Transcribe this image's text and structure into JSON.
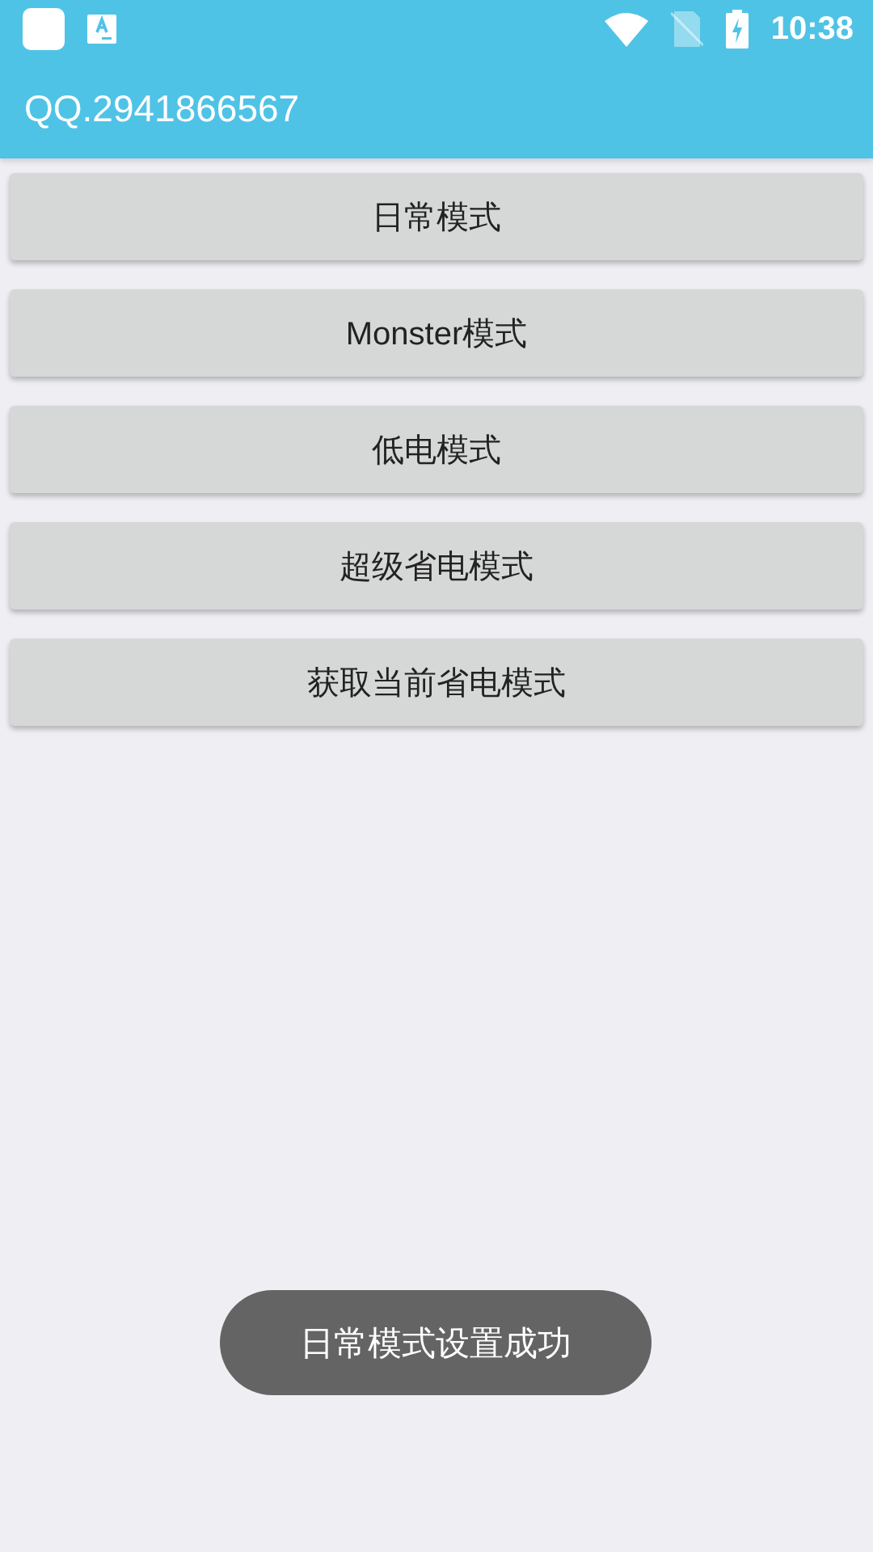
{
  "status_bar": {
    "time": "10:38"
  },
  "app_bar": {
    "title": "QQ.2941866567"
  },
  "buttons": [
    "日常模式",
    "Monster模式",
    "低电模式",
    "超级省电模式",
    "获取当前省电模式"
  ],
  "toast": {
    "message": "日常模式设置成功"
  }
}
